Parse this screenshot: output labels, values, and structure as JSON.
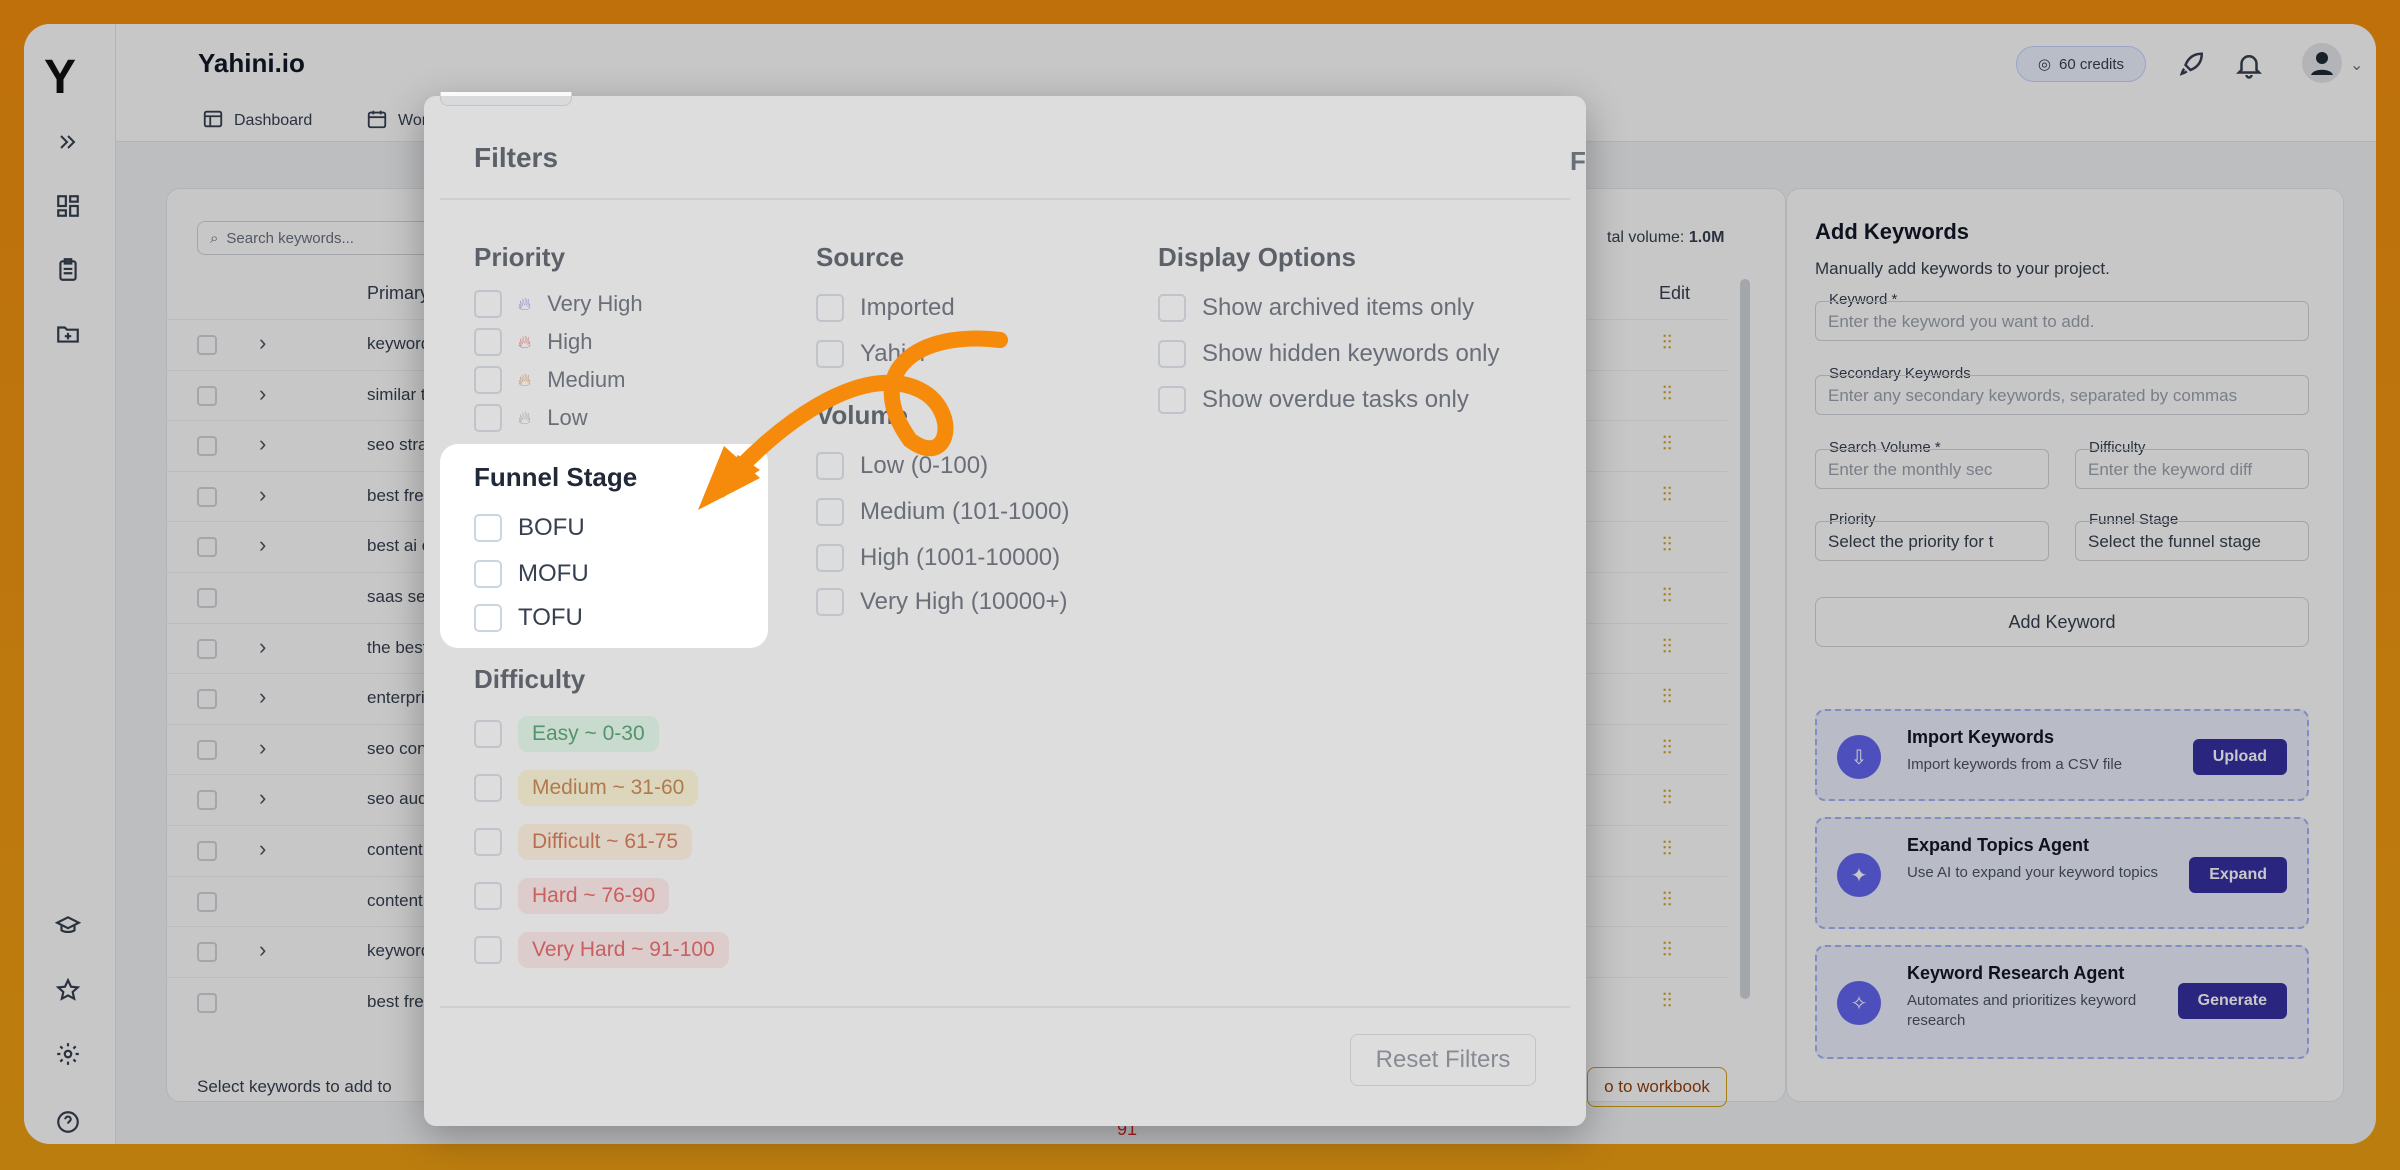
{
  "app": {
    "title": "Yahini.io",
    "logo": "Y"
  },
  "topbar": {
    "tabs": [
      {
        "label": "Dashboard",
        "icon": "dashboard-icon"
      },
      {
        "label": "Workb",
        "icon": "calendar-icon"
      }
    ],
    "credits": "60 credits"
  },
  "rail": {
    "icons": [
      "expand-icon",
      "grid-icon",
      "clipboard-icon",
      "folder-plus-icon",
      "graduation-cap-icon",
      "star-icon",
      "gear-icon",
      "help-icon"
    ]
  },
  "table": {
    "search_placeholder": "Search keywords...",
    "column_primary": "Primary K",
    "column_edit": "Edit",
    "total_volume_label": "tal volume:",
    "total_volume_value": "1.0M",
    "rows": [
      "keyword r",
      "similar to",
      "seo strate",
      "best free",
      "best ai co",
      "saas seo",
      "the best k",
      "enterprise",
      "seo conte",
      "seo audit",
      "content c",
      "content c",
      "keyword r",
      "best free"
    ],
    "footer_text": "Select keywords to add to",
    "footer_button": "o to workbook",
    "background_number": "91"
  },
  "right_panel": {
    "title": "Add Keywords",
    "subtitle": "Manually add keywords to your project.",
    "keyword_label": "Keyword *",
    "keyword_placeholder": "Enter the keyword you want to add.",
    "secondary_label": "Secondary Keywords",
    "secondary_placeholder": "Enter any secondary keywords, separated by commas",
    "volume_label": "Search Volume *",
    "volume_placeholder": "Enter the monthly sec",
    "difficulty_label": "Difficulty",
    "difficulty_placeholder": "Enter the keyword diff",
    "priority_label": "Priority",
    "priority_placeholder": "Select the priority for t",
    "funnel_label": "Funnel Stage",
    "funnel_placeholder": "Select the funnel stage",
    "add_button": "Add Keyword",
    "agents": [
      {
        "title": "Import Keywords",
        "desc": "Import keywords from a CSV file",
        "button": "Upload"
      },
      {
        "title": "Expand Topics Agent",
        "desc": "Use AI to expand your keyword topics",
        "button": "Expand"
      },
      {
        "title": "Keyword Research Agent",
        "desc": "Automates and prioritizes keyword research",
        "button": "Generate"
      }
    ]
  },
  "modal": {
    "title": "Filters",
    "priority": {
      "heading": "Priority",
      "options": [
        "Very High",
        "High",
        "Medium",
        "Low"
      ]
    },
    "funnel": {
      "heading": "Funnel Stage",
      "options": [
        "BOFU",
        "MOFU",
        "TOFU"
      ]
    },
    "difficulty": {
      "heading": "Difficulty",
      "options": [
        "Easy ~ 0-30",
        "Medium ~ 31-60",
        "Difficult ~ 61-75",
        "Hard ~ 76-90",
        "Very Hard ~ 91-100"
      ]
    },
    "source": {
      "heading": "Source",
      "options": [
        "Imported",
        "Yahini"
      ]
    },
    "volume": {
      "heading": "Volume",
      "options": [
        "Low (0-100)",
        "Medium (101-1000)",
        "High (1001-10000)",
        "Very High (10000+)"
      ]
    },
    "display": {
      "heading": "Display Options",
      "options": [
        "Show archived items only",
        "Show hidden keywords only",
        "Show overdue tasks only"
      ]
    },
    "reset_button": "Reset Filters",
    "behind_title": "F"
  },
  "colors": {
    "accent_orange": "#f5900f",
    "primary_indigo": "#3730a3",
    "easy": "#15803d",
    "medium": "#b45309",
    "difficult": "#c2410c",
    "hard": "#dc2626"
  }
}
